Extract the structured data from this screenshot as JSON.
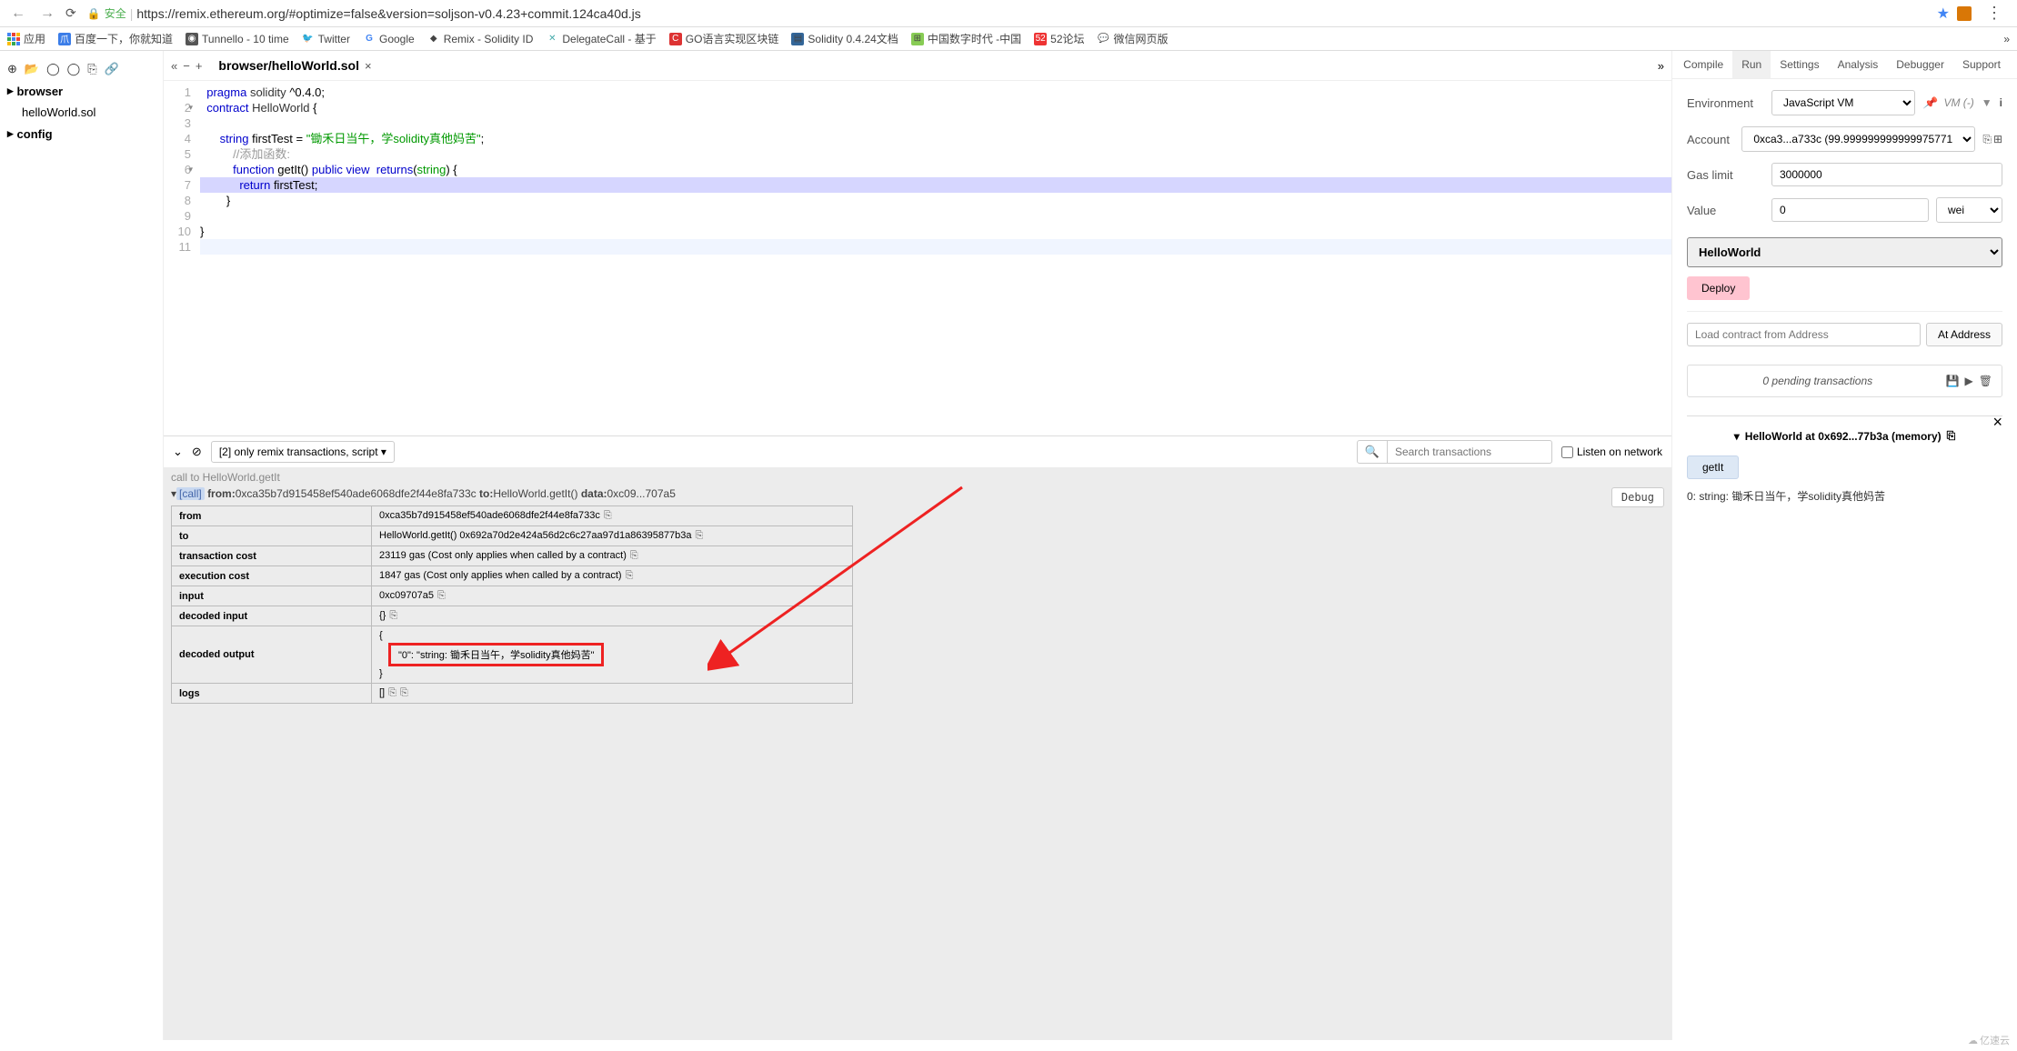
{
  "browser": {
    "secure_label": "安全",
    "url": "https://remix.ethereum.org/#optimize=false&version=soljson-v0.4.23+commit.124ca40d.js"
  },
  "bookmarks": {
    "apps": "应用",
    "items": [
      {
        "label": "百度一下，你就知道"
      },
      {
        "label": "Tunnello - 10 time"
      },
      {
        "label": "Twitter"
      },
      {
        "label": "Google"
      },
      {
        "label": "Remix - Solidity ID"
      },
      {
        "label": "DelegateCall - 基于"
      },
      {
        "label": "GO语言实现区块链"
      },
      {
        "label": "Solidity 0.4.24文档"
      },
      {
        "label": "中国数字时代 -中国"
      },
      {
        "label": "52论坛"
      },
      {
        "label": "微信网页版"
      }
    ]
  },
  "tree": {
    "browser": "browser",
    "file": "helloWorld.sol",
    "config": "config"
  },
  "tab": {
    "file": "browser/helloWorld.sol"
  },
  "editor": {
    "lines": [
      {
        "n": "1"
      },
      {
        "n": "2"
      },
      {
        "n": "3"
      },
      {
        "n": "4"
      },
      {
        "n": "5"
      },
      {
        "n": "6"
      },
      {
        "n": "7"
      },
      {
        "n": "8"
      },
      {
        "n": "9"
      },
      {
        "n": "10"
      },
      {
        "n": "11"
      }
    ],
    "l1_pragma": "pragma",
    "l1_sol": "solidity",
    "l1_ver": "^0.4.0",
    "l2_contract": "contract",
    "l2_name": "HelloWorld",
    "l2_brace": "{",
    "l4_string": "string",
    "l4_var": "firstTest = ",
    "l4_val": "\"锄禾日当午，学solidity真他妈苦\"",
    "l4_semi": ";",
    "l5_cmt": "//添加函数:",
    "l6_function": "function",
    "l6_name": "getIt()",
    "l6_public": "public",
    "l6_view": "view",
    "l6_returns": "returns",
    "l6_rtype": "string",
    "l6_brace": ") {",
    "l7_return": "return",
    "l7_val": "firstTest;",
    "l8": "        }",
    "l10": "}"
  },
  "terminal_bar": {
    "filter": "[2] only remix transactions, script",
    "search_placeholder": "Search transactions",
    "listen": "Listen on network"
  },
  "terminal": {
    "pre_call": "call to HelloWorld.getIt",
    "call_line_call": "[call]",
    "call_line_from": "from:",
    "call_line_from_val": "0xca35b7d915458ef540ade6068dfe2f44e8fa733c",
    "call_line_to": "to:",
    "call_line_to_val": "HelloWorld.getIt()",
    "call_line_data": "data:",
    "call_line_data_val": "0xc09...707a5",
    "debug": "Debug",
    "rows": {
      "from_label": "from",
      "from_val": "0xca35b7d915458ef540ade6068dfe2f44e8fa733c",
      "to_label": "to",
      "to_val": "HelloWorld.getIt() 0x692a70d2e424a56d2c6c27aa97d1a86395877b3a",
      "tc_label": "transaction cost",
      "tc_val": "23119 gas (Cost only applies when called by a contract)",
      "ec_label": "execution cost",
      "ec_val": "1847 gas (Cost only applies when called by a contract)",
      "input_label": "input",
      "input_val": "0xc09707a5",
      "din_label": "decoded input",
      "din_val": "{}",
      "dout_label": "decoded output",
      "dout_open": "{",
      "dout_close": "}",
      "dout_val": "\"0\": \"string: 锄禾日当午，学solidity真他妈苦\"",
      "logs_label": "logs",
      "logs_val": "[]"
    }
  },
  "panel": {
    "tabs": {
      "compile": "Compile",
      "run": "Run",
      "settings": "Settings",
      "analysis": "Analysis",
      "debugger": "Debugger",
      "support": "Support"
    },
    "env_label": "Environment",
    "env_val": "JavaScript VM",
    "vm_info": "VM (-)",
    "account_label": "Account",
    "account_val": "0xca3...a733c (99.999999999999975771",
    "gas_label": "Gas limit",
    "gas_val": "3000000",
    "value_label": "Value",
    "value_val": "0",
    "value_unit": "wei",
    "contract": "HelloWorld",
    "deploy": "Deploy",
    "load_placeholder": "Load contract from Address",
    "at_address": "At Address",
    "pending": "0 pending transactions",
    "instance_title": "HelloWorld at 0x692...77b3a (memory)",
    "getit": "getIt",
    "result": "0: string: 锄禾日当午，学solidity真他妈苦"
  },
  "watermark": "亿速云"
}
